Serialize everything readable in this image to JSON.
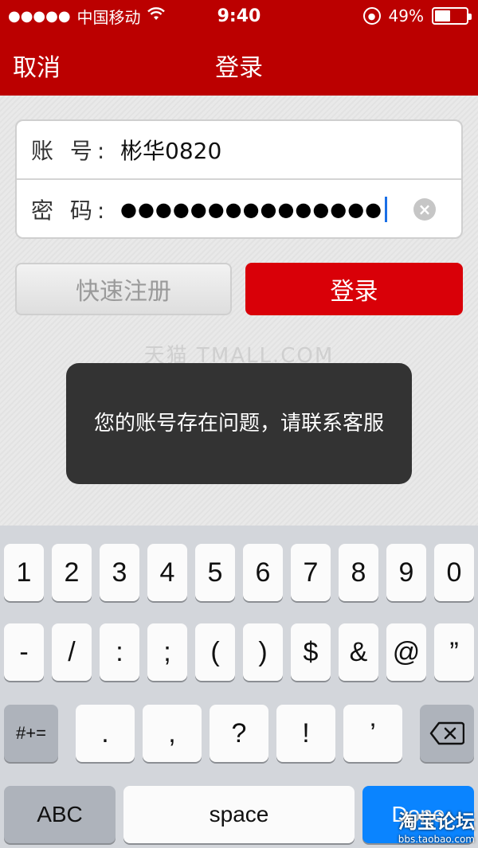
{
  "status": {
    "signal_dots": "●●●●●",
    "carrier": "中国移动",
    "time": "9:40",
    "battery_percent": "49%",
    "battery_level": 0.49
  },
  "nav": {
    "cancel": "取消",
    "title": "登录"
  },
  "form": {
    "account_label": "账 号:",
    "account_value": "彬华0820",
    "password_label": "密 码:",
    "password_dots": "●●●●●●●●●●●●●●●"
  },
  "buttons": {
    "register": "快速注册",
    "login": "登录"
  },
  "watermark": "天猫 TMALL.COM",
  "toast": {
    "message": "您的账号存在问题，请联系客服"
  },
  "keyboard": {
    "row1": [
      "1",
      "2",
      "3",
      "4",
      "5",
      "6",
      "7",
      "8",
      "9",
      "0"
    ],
    "row2": [
      "-",
      "/",
      ":",
      ";",
      "(",
      ")",
      "$",
      "&",
      "@",
      "”"
    ],
    "row3": {
      "toggle": "#+=",
      "keys": [
        ".",
        ",",
        "?",
        "!",
        "’"
      ]
    },
    "row4": {
      "abc": "ABC",
      "space": "space",
      "done": "Done"
    }
  },
  "footer_watermark": {
    "title": "淘宝论坛",
    "url": "bbs.taobao.com"
  },
  "colors": {
    "brand_red": "#bb0000",
    "login_red": "#d90008",
    "done_blue": "#0a84ff"
  }
}
